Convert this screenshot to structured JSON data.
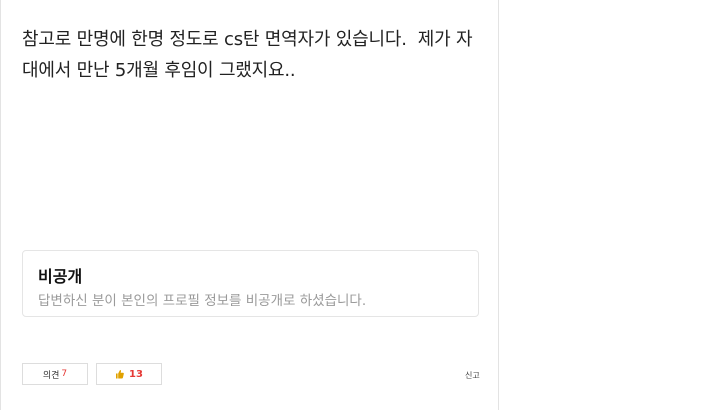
{
  "answer": {
    "body": "참고로 만명에 한명 정도로 cs탄 면역자가 있습니다.  제가 자대에서 만난 5개월 후임이 그랬지요.."
  },
  "private_profile": {
    "title": "비공개",
    "description": "답변하신 분이 본인의 프로필 정보를 비공개로 하셨습니다."
  },
  "actions": {
    "opinion_label": "의견",
    "opinion_count": "7",
    "like_count": "13",
    "report_label": "신고"
  },
  "colors": {
    "count_accent": "#e53935",
    "like_icon": "#e0a100"
  }
}
